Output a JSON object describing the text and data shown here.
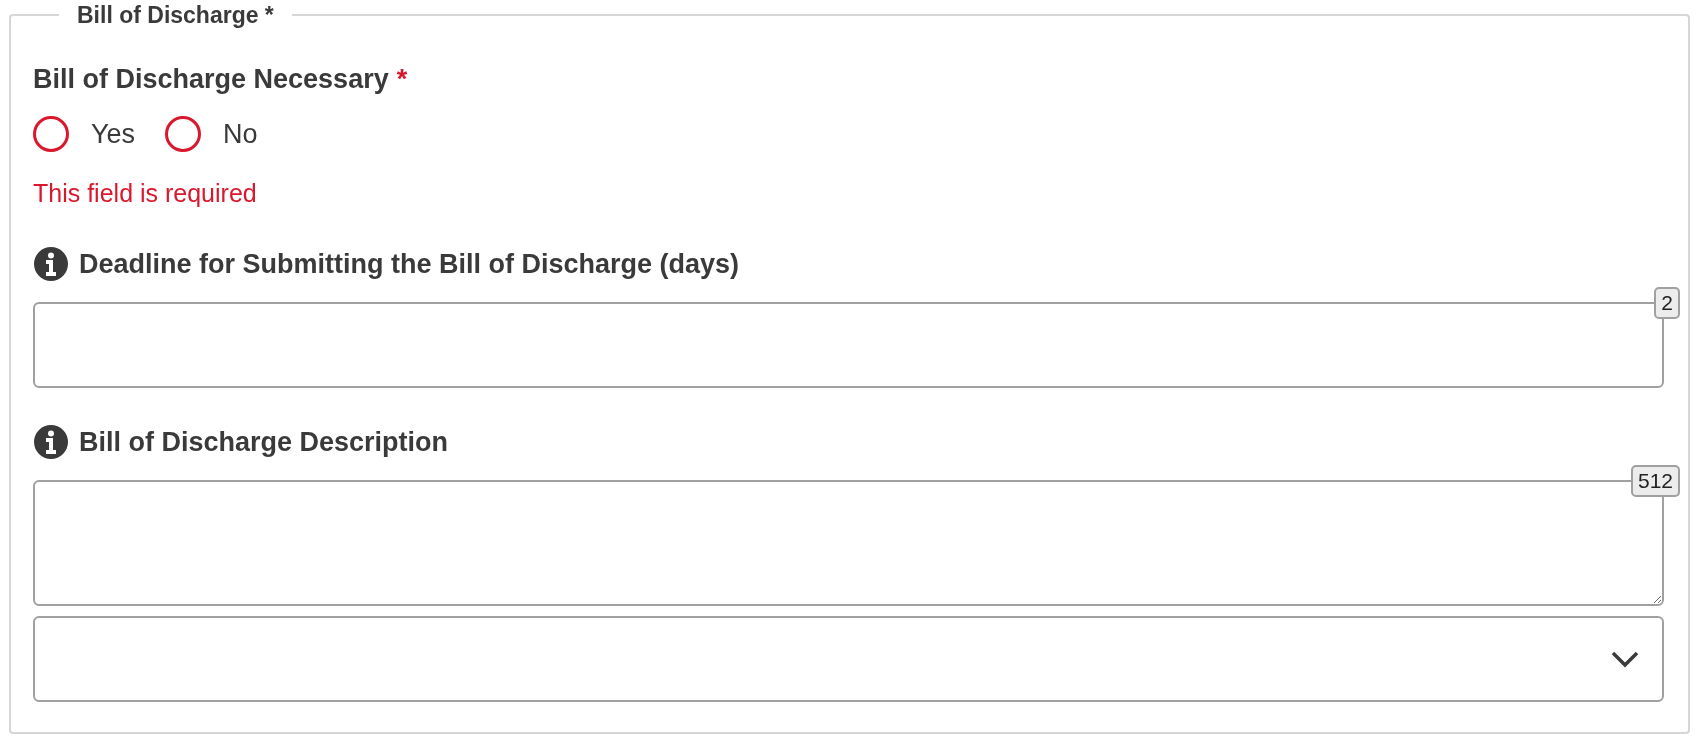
{
  "legend": "Bill of Discharge *",
  "question": {
    "label": "Bill of Discharge Necessary",
    "required_mark": "*",
    "invalid": true,
    "options": [
      {
        "label": "Yes",
        "selected": false
      },
      {
        "label": "No",
        "selected": false
      }
    ],
    "error": "This field is required"
  },
  "fields": [
    {
      "kind": "text",
      "label": "Deadline for Submitting the Bill of Discharge (days)",
      "counter": "2"
    },
    {
      "kind": "textarea",
      "label": "Bill of Discharge Description",
      "counter": "512"
    },
    {
      "kind": "select"
    }
  ]
}
